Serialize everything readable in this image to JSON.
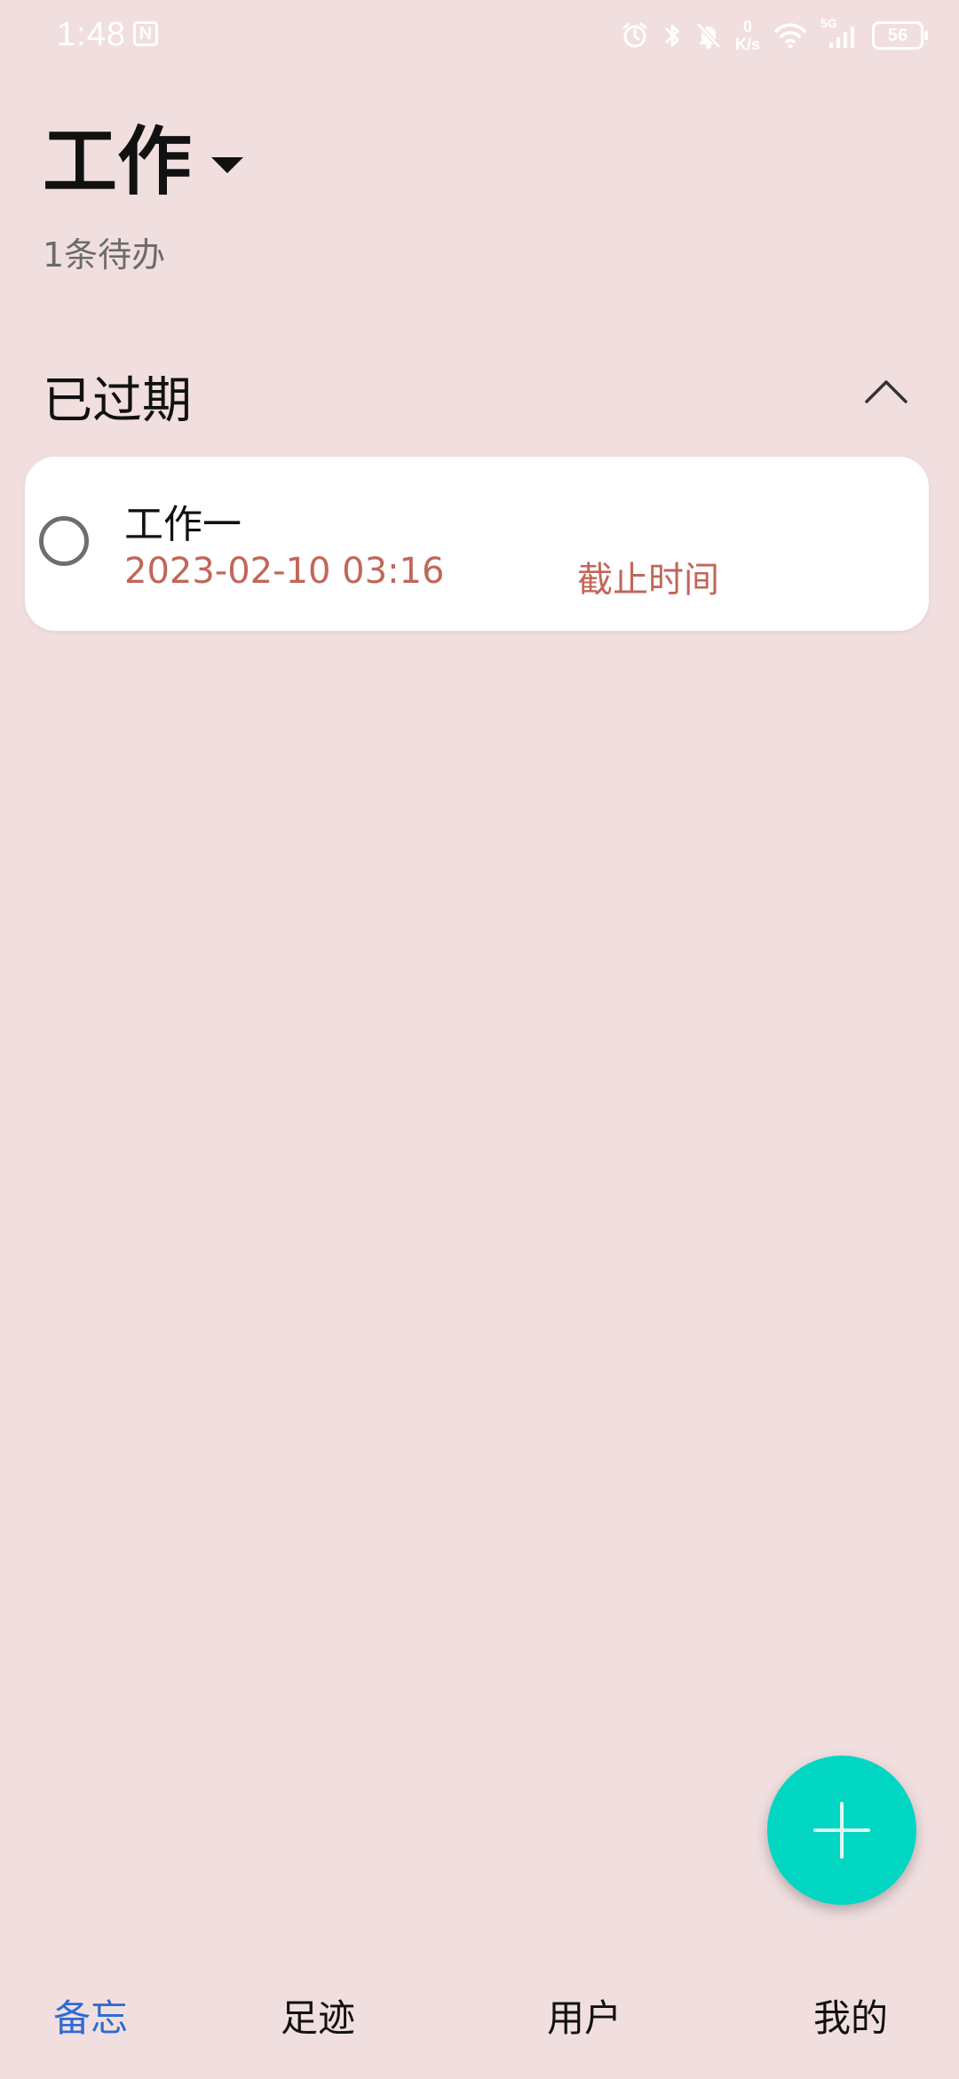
{
  "status_bar": {
    "time": "1:48",
    "nfc_label": "N",
    "net_speed_value": "0",
    "net_speed_unit": "K/s",
    "signal_label": "5G",
    "battery": "56"
  },
  "header": {
    "title": "工作",
    "subtitle": "1条待办"
  },
  "section": {
    "title": "已过期"
  },
  "tasks": [
    {
      "title": "工作一",
      "date": "2023-02-10 03:16",
      "deadline_label": "截止时间"
    }
  ],
  "bottom_nav": {
    "items": [
      {
        "label": "备忘",
        "active": true
      },
      {
        "label": "足迹",
        "active": false
      },
      {
        "label": "用户",
        "active": false
      },
      {
        "label": "我的",
        "active": false
      }
    ]
  },
  "colors": {
    "background": "#f1dfe0",
    "accent_due": "#c0675a",
    "fab": "#00d6c2",
    "nav_active": "#2f6cd0"
  },
  "icons": {
    "dropdown": "caret-down-icon",
    "collapse": "chevron-up-icon",
    "fab": "plus-icon",
    "task_check": "circle-outline-icon"
  }
}
